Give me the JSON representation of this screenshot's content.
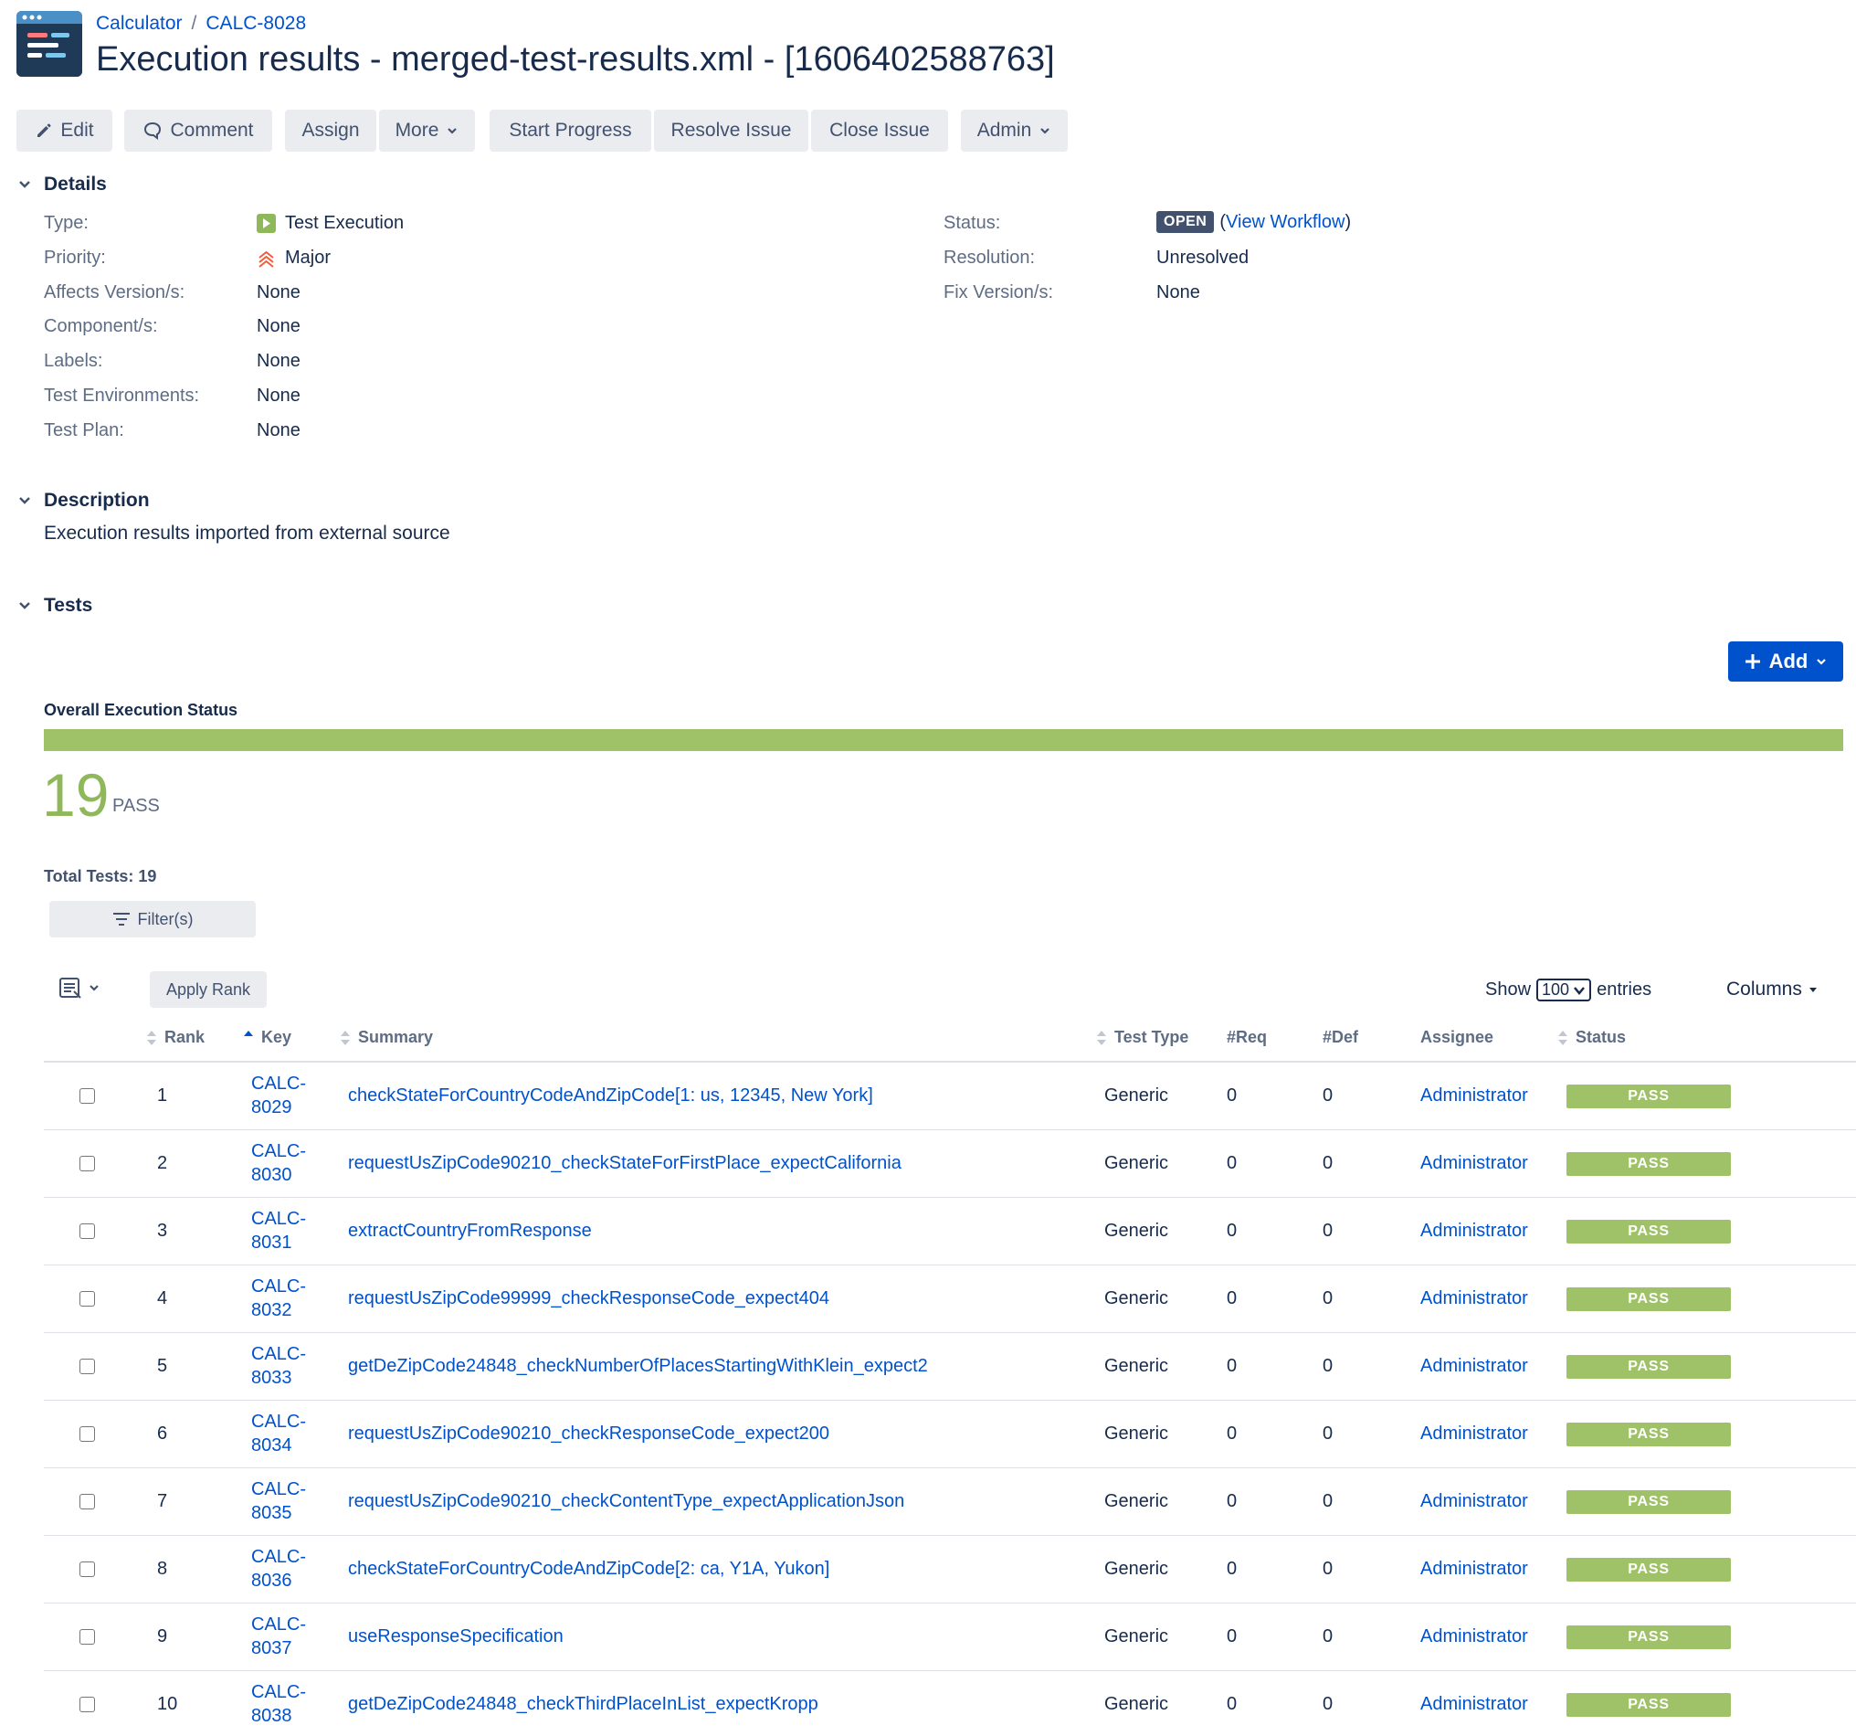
{
  "breadcrumb": {
    "project": "Calculator",
    "separator": "/",
    "issue_key": "CALC-8028"
  },
  "page_title": "Execution results - merged-test-results.xml - [1606402588763]",
  "toolbar": {
    "edit": "Edit",
    "comment": "Comment",
    "assign": "Assign",
    "more": "More",
    "start_progress": "Start Progress",
    "resolve_issue": "Resolve Issue",
    "close_issue": "Close Issue",
    "admin": "Admin"
  },
  "details": {
    "title": "Details",
    "type_label": "Type:",
    "type_value": "Test Execution",
    "priority_label": "Priority:",
    "priority_value": "Major",
    "affects_label": "Affects Version/s:",
    "affects_value": "None",
    "component_label": "Component/s:",
    "component_value": "None",
    "labels_label": "Labels:",
    "labels_value": "None",
    "test_env_label": "Test Environments:",
    "test_env_value": "None",
    "test_plan_label": "Test Plan:",
    "test_plan_value": "None",
    "status_label": "Status:",
    "status_value": "OPEN",
    "view_workflow_open": "(",
    "view_workflow": "View Workflow",
    "view_workflow_close": ")",
    "resolution_label": "Resolution:",
    "resolution_value": "Unresolved",
    "fix_label": "Fix Version/s:",
    "fix_value": "None"
  },
  "description": {
    "title": "Description",
    "text": "Execution results imported from external source"
  },
  "tests": {
    "title": "Tests",
    "add_label": "Add",
    "overall_label": "Overall Execution Status",
    "progress_pass_fraction": 1.0,
    "pass_count": "19",
    "pass_label": "PASS",
    "total_tests": "Total Tests: 19",
    "filter_label": "Filter(s)",
    "apply_rank": "Apply Rank",
    "show_label": "Show",
    "show_value": "100",
    "entries_label": "entries",
    "columns_label": "Columns",
    "headers": {
      "rank": "Rank",
      "key": "Key",
      "summary": "Summary",
      "test_type": "Test Type",
      "req": "#Req",
      "def": "#Def",
      "assignee": "Assignee",
      "status": "Status"
    },
    "rows": [
      {
        "rank": "1",
        "key1": "CALC-",
        "key2": "8029",
        "summary": "checkStateForCountryCodeAndZipCode[1: us, 12345, New York]",
        "test_type": "Generic",
        "req": "0",
        "def": "0",
        "assignee": "Administrator",
        "status": "PASS"
      },
      {
        "rank": "2",
        "key1": "CALC-",
        "key2": "8030",
        "summary": "requestUsZipCode90210_checkStateForFirstPlace_expectCalifornia",
        "test_type": "Generic",
        "req": "0",
        "def": "0",
        "assignee": "Administrator",
        "status": "PASS"
      },
      {
        "rank": "3",
        "key1": "CALC-",
        "key2": "8031",
        "summary": "extractCountryFromResponse",
        "test_type": "Generic",
        "req": "0",
        "def": "0",
        "assignee": "Administrator",
        "status": "PASS"
      },
      {
        "rank": "4",
        "key1": "CALC-",
        "key2": "8032",
        "summary": "requestUsZipCode99999_checkResponseCode_expect404",
        "test_type": "Generic",
        "req": "0",
        "def": "0",
        "assignee": "Administrator",
        "status": "PASS"
      },
      {
        "rank": "5",
        "key1": "CALC-",
        "key2": "8033",
        "summary": "getDeZipCode24848_checkNumberOfPlacesStartingWithKlein_expect2",
        "test_type": "Generic",
        "req": "0",
        "def": "0",
        "assignee": "Administrator",
        "status": "PASS"
      },
      {
        "rank": "6",
        "key1": "CALC-",
        "key2": "8034",
        "summary": "requestUsZipCode90210_checkResponseCode_expect200",
        "test_type": "Generic",
        "req": "0",
        "def": "0",
        "assignee": "Administrator",
        "status": "PASS"
      },
      {
        "rank": "7",
        "key1": "CALC-",
        "key2": "8035",
        "summary": "requestUsZipCode90210_checkContentType_expectApplicationJson",
        "test_type": "Generic",
        "req": "0",
        "def": "0",
        "assignee": "Administrator",
        "status": "PASS"
      },
      {
        "rank": "8",
        "key1": "CALC-",
        "key2": "8036",
        "summary": "checkStateForCountryCodeAndZipCode[2: ca, Y1A, Yukon]",
        "test_type": "Generic",
        "req": "0",
        "def": "0",
        "assignee": "Administrator",
        "status": "PASS"
      },
      {
        "rank": "9",
        "key1": "CALC-",
        "key2": "8037",
        "summary": "useResponseSpecification",
        "test_type": "Generic",
        "req": "0",
        "def": "0",
        "assignee": "Administrator",
        "status": "PASS"
      },
      {
        "rank": "10",
        "key1": "CALC-",
        "key2": "8038",
        "summary": "getDeZipCode24848_checkThirdPlaceInList_expectKropp",
        "test_type": "Generic",
        "req": "0",
        "def": "0",
        "assignee": "Administrator",
        "status": "PASS"
      }
    ]
  },
  "colors": {
    "accent": "#0052cc",
    "pass": "#9fc167",
    "pass_text": "#8fb85b",
    "lozenge": "#42526e",
    "priority_major": "#f15c3b",
    "test_exec_icon": "#8fb85b"
  },
  "icons": [
    "project-avatar-icon",
    "pencil-icon",
    "comment-icon",
    "chevron-down-icon",
    "test-execution-icon",
    "priority-major-icon",
    "plus-icon",
    "filter-icon",
    "list-view-icon",
    "sort-icon",
    "sort-asc-icon"
  ]
}
